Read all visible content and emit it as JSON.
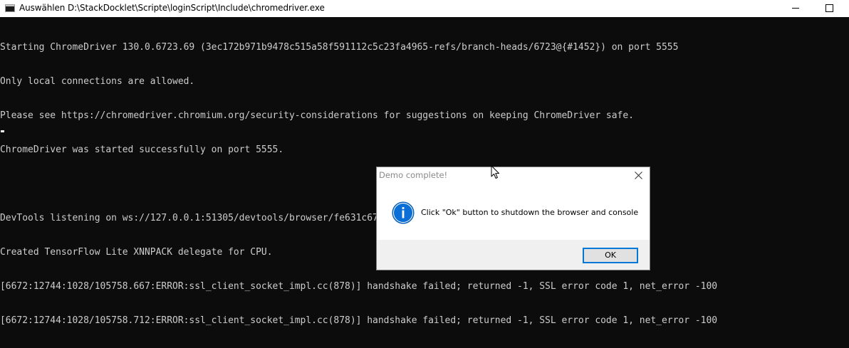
{
  "window": {
    "title": "Auswählen D:\\StackDocklet\\Scripte\\loginScript\\Include\\chromedriver.exe"
  },
  "console": {
    "lines": [
      "Starting ChromeDriver 130.0.6723.69 (3ec172b971b9478c515a58f591112c5c23fa4965-refs/branch-heads/6723@{#1452}) on port 5555",
      "Only local connections are allowed.",
      "Please see https://chromedriver.chromium.org/security-considerations for suggestions on keeping ChromeDriver safe.",
      "ChromeDriver was started successfully on port 5555.",
      "",
      "DevTools listening on ws://127.0.0.1:51305/devtools/browser/fe631c67-96cf-4fc2-a983-27288149bbae",
      "Created TensorFlow Lite XNNPACK delegate for CPU.",
      "[6672:12744:1028/105758.667:ERROR:ssl_client_socket_impl.cc(878)] handshake failed; returned -1, SSL error code 1, net_error -100",
      "[6672:12744:1028/105758.712:ERROR:ssl_client_socket_impl.cc(878)] handshake failed; returned -1, SSL error code 1, net_error -100"
    ]
  },
  "dialog": {
    "title": "Demo complete!",
    "message": "Click \"Ok\" button to shutdown the browser and console",
    "ok_label": "OK",
    "icon": "info-icon"
  },
  "colors": {
    "console_bg": "#0c0c0c",
    "console_text": "#cccccc",
    "info_blue": "#0a6fd6",
    "focus_border": "#0078d7"
  }
}
